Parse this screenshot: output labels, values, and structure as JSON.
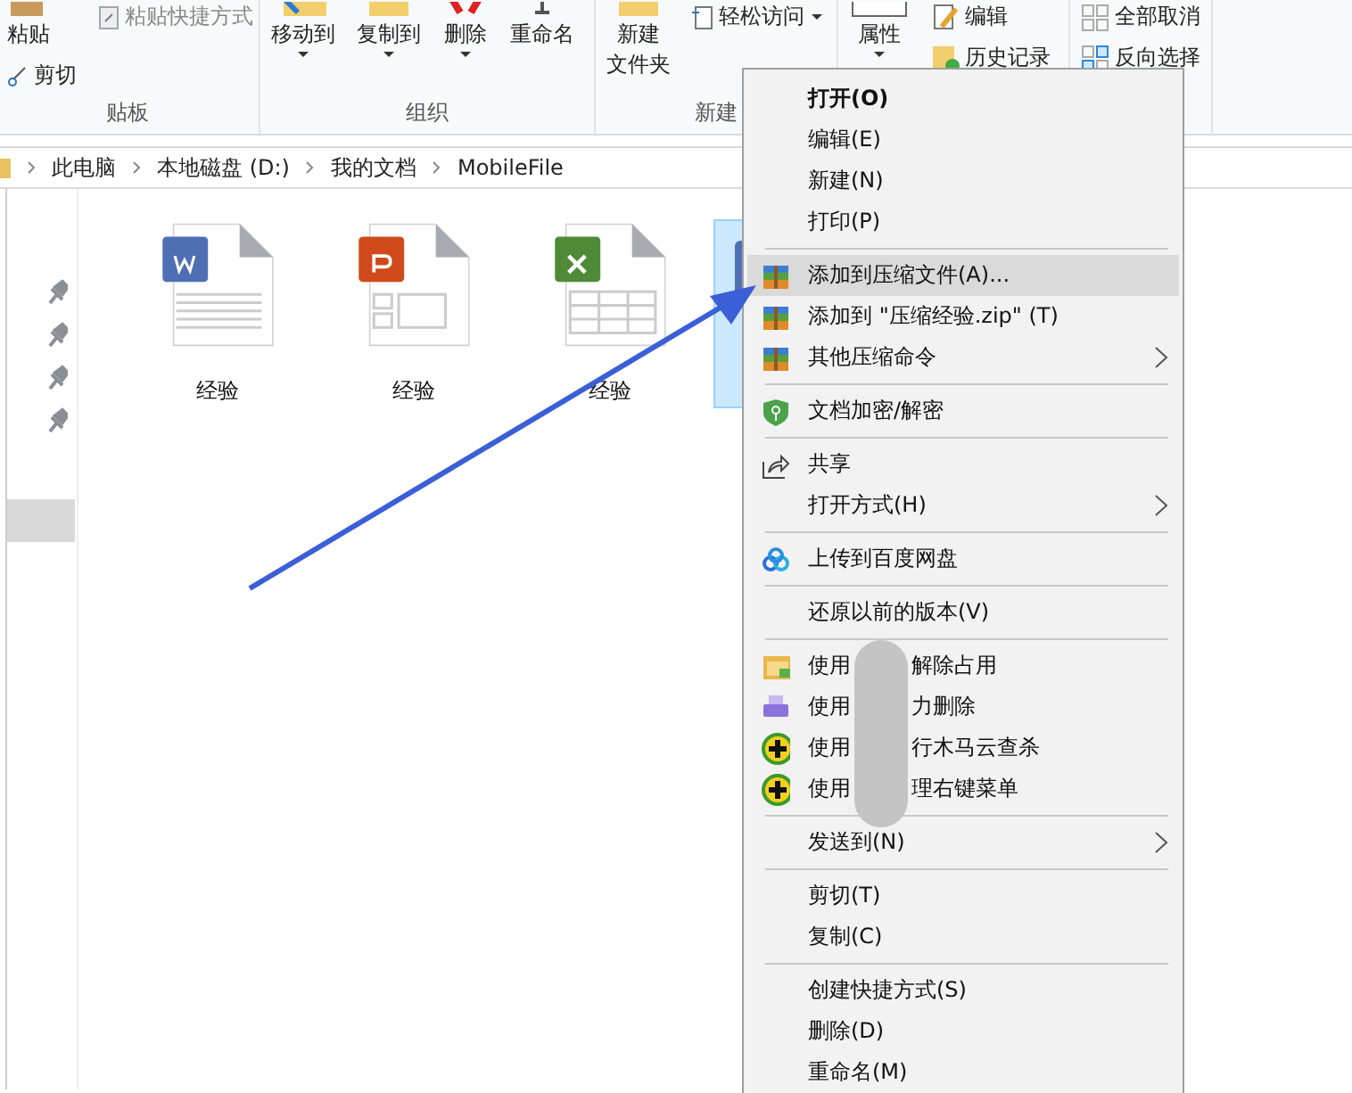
{
  "ribbon": {
    "groups": [
      {
        "label": "贴板",
        "columns": [
          [
            {
              "text": "粘贴",
              "kind": "large-text"
            },
            {
              "text": "剪切",
              "kind": "small"
            }
          ],
          [
            {
              "text": "粘贴快捷方式",
              "kind": "small",
              "disabled": true
            }
          ]
        ]
      },
      {
        "label": "组织",
        "columns": [
          [
            {
              "text": "移动到",
              "kind": "large",
              "caret": true
            }
          ],
          [
            {
              "text": "复制到",
              "kind": "large",
              "caret": true
            }
          ],
          [
            {
              "text": "删除",
              "kind": "large",
              "caret": true
            }
          ],
          [
            {
              "text": "重命名",
              "kind": "large"
            }
          ]
        ]
      },
      {
        "label": "新建",
        "columns": [
          [
            {
              "lines": [
                "新建",
                "文件夹"
              ],
              "kind": "large"
            }
          ],
          [
            {
              "text": "轻松访问",
              "kind": "small",
              "caret": true
            }
          ]
        ]
      },
      {
        "columns": [
          [
            {
              "text": "属性",
              "kind": "large",
              "caret": true
            }
          ],
          [
            {
              "text": "编辑",
              "kind": "small"
            },
            {
              "text": "历史记录",
              "kind": "small"
            }
          ]
        ]
      },
      {
        "columns": [
          [
            {
              "text": "全部取消",
              "kind": "small"
            },
            {
              "text": "反向选择",
              "kind": "small"
            }
          ]
        ]
      }
    ]
  },
  "address_bar": {
    "crumbs": [
      "此电脑",
      "本地磁盘 (D:)",
      "我的文档",
      "MobileFile"
    ]
  },
  "nav_pane": {
    "items": [
      {
        "pinned": true,
        "selected": false
      },
      {
        "pinned": true,
        "selected": false
      },
      {
        "pinned": true,
        "selected": false
      },
      {
        "pinned": true,
        "selected": false
      },
      {
        "pinned": false,
        "selected": true
      }
    ]
  },
  "files": [
    {
      "name": "经验",
      "kind": "word",
      "selected": false
    },
    {
      "name": "经验",
      "kind": "ppt",
      "selected": false
    },
    {
      "name": "经验",
      "kind": "excel",
      "selected": false
    },
    {
      "kind": "word",
      "selected": true
    }
  ],
  "context_menu": {
    "items": [
      {
        "kind": "item",
        "label": "打开(O)",
        "default": true,
        "selected": false
      },
      {
        "kind": "item",
        "label": "编辑(E)",
        "selected": false
      },
      {
        "kind": "item",
        "label": "新建(N)",
        "selected": false
      },
      {
        "kind": "item",
        "label": "打印(P)",
        "selected": false
      },
      {
        "kind": "separator"
      },
      {
        "kind": "item",
        "label": "添加到压缩文件(A)...",
        "selected": true
      },
      {
        "kind": "item",
        "label": "添加到 \"压缩经验.zip\" (T)",
        "selected": false
      },
      {
        "kind": "item",
        "label": "其他压缩命令",
        "submenu": true,
        "selected": false
      },
      {
        "kind": "separator"
      },
      {
        "kind": "item",
        "label": "文档加密/解密",
        "selected": false
      },
      {
        "kind": "separator"
      },
      {
        "kind": "item",
        "label": "共享",
        "selected": false
      },
      {
        "kind": "item",
        "label": "打开方式(H)",
        "submenu": true,
        "selected": false
      },
      {
        "kind": "separator"
      },
      {
        "kind": "item",
        "label": "上传到百度网盘",
        "selected": false
      },
      {
        "kind": "separator"
      },
      {
        "kind": "item",
        "label": "还原以前的版本(V)",
        "selected": false
      },
      {
        "kind": "separator"
      },
      {
        "kind": "item",
        "label": "使用",
        "label_after": "解除占用",
        "selected": false
      },
      {
        "kind": "item",
        "label": "使用",
        "label_after": "力删除",
        "selected": false
      },
      {
        "kind": "item",
        "label": "使用",
        "label_after": "行木马云查杀",
        "selected": false
      },
      {
        "kind": "item",
        "label": "使用",
        "label_after": "理右键菜单",
        "selected": false
      },
      {
        "kind": "separator"
      },
      {
        "kind": "item",
        "label": "发送到(N)",
        "submenu": true,
        "selected": false
      },
      {
        "kind": "separator"
      },
      {
        "kind": "item",
        "label": "剪切(T)",
        "selected": false
      },
      {
        "kind": "item",
        "label": "复制(C)",
        "selected": false
      },
      {
        "kind": "separator"
      },
      {
        "kind": "item",
        "label": "创建快捷方式(S)",
        "selected": false
      },
      {
        "kind": "item",
        "label": "删除(D)",
        "selected": false
      },
      {
        "kind": "item",
        "label": "重命名(M)",
        "selected": false
      }
    ]
  }
}
